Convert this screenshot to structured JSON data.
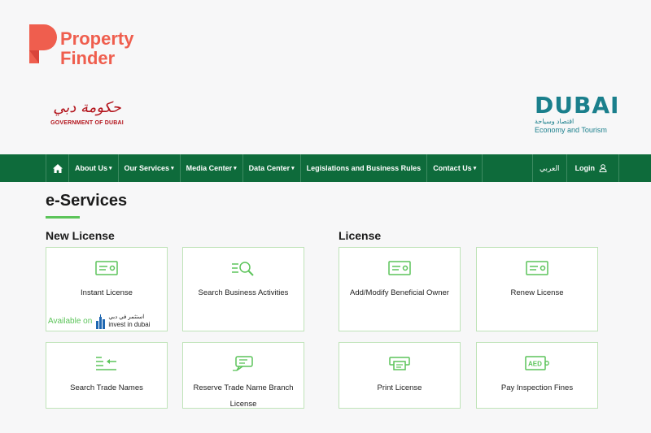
{
  "brand": {
    "name_line1": "Property",
    "name_line2": "Finder",
    "color": "#ef5e4e"
  },
  "gov_logo": {
    "arabic": "حكومة دبي",
    "text": "GOVERNMENT OF DUBAI"
  },
  "dubai_logo": {
    "word": "DUBAI",
    "arabic": "اقتصاد وسياحة",
    "english": "Economy and Tourism"
  },
  "nav": {
    "home_icon": "home-icon",
    "items": [
      {
        "label": "About Us",
        "dropdown": true
      },
      {
        "label": "Our Services",
        "dropdown": true
      },
      {
        "label": "Media Center",
        "dropdown": true
      },
      {
        "label": "Data Center",
        "dropdown": true
      },
      {
        "label": "Legislations and Business Rules",
        "dropdown": false
      },
      {
        "label": "Contact Us",
        "dropdown": true
      }
    ],
    "language": "العربي",
    "login": "Login",
    "login_icon": "user-icon",
    "color": "#0e6b3b"
  },
  "page": {
    "title": "e-Services",
    "accent": "#5cc45a"
  },
  "sections": {
    "new_license": {
      "title": "New License",
      "cards": [
        {
          "label": "Instant License",
          "icon": "license-card-icon"
        },
        {
          "label": "Search Business Activities",
          "icon": "search-list-icon"
        },
        {
          "label": "Search Trade Names",
          "icon": "arrow-list-icon"
        },
        {
          "label": "Reserve Trade Name Branch License",
          "icon": "chat-bubble-icon"
        }
      ],
      "available_on": "Available on",
      "invest_ar": "استثمر في دبي",
      "invest_en": "invest in dubai"
    },
    "license": {
      "title": "License",
      "cards": [
        {
          "label": "Add/Modify Beneficial Owner",
          "icon": "license-card-icon"
        },
        {
          "label": "Renew License",
          "icon": "license-card-icon"
        },
        {
          "label": "Print License",
          "icon": "printer-icon"
        },
        {
          "label": "Pay Inspection Fines",
          "icon": "aed-fine-icon"
        }
      ]
    }
  }
}
